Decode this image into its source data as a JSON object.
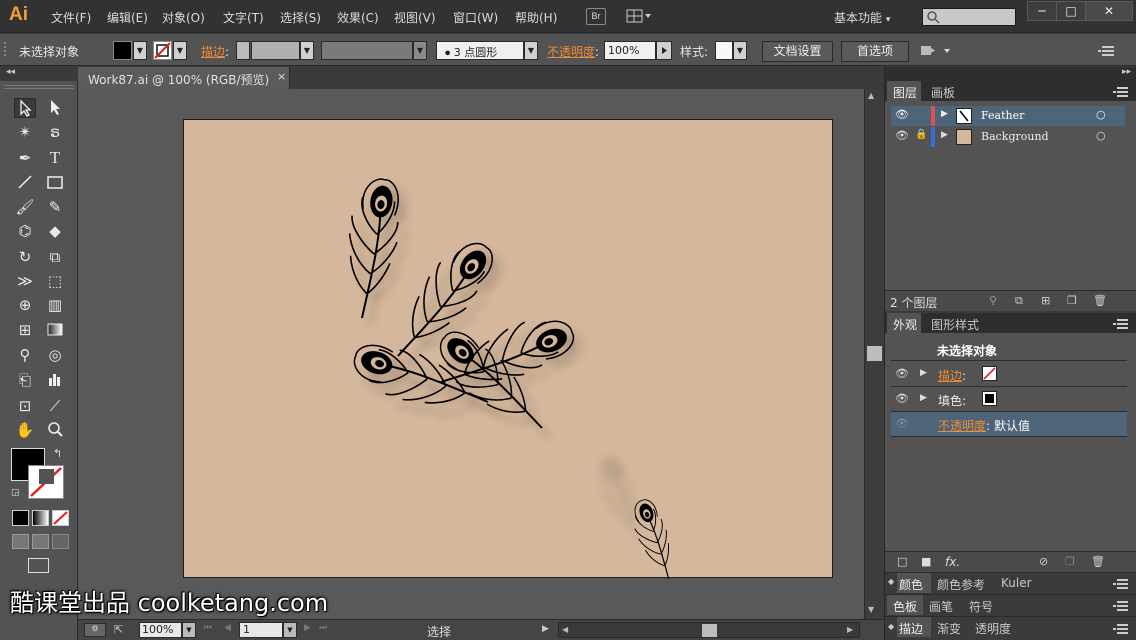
{
  "app": {
    "logo": "Ai"
  },
  "menu": [
    "文件(F)",
    "编辑(E)",
    "对象(O)",
    "文字(T)",
    "选择(S)",
    "效果(C)",
    "视图(V)",
    "窗口(W)",
    "帮助(H)"
  ],
  "menubar": {
    "bridge_label": "Br",
    "workspace": "基本功能",
    "workspace_arrow": "▾",
    "win_min": "─",
    "win_max": "□",
    "win_close": "✕"
  },
  "control": {
    "selection_text": "未选择对象",
    "stroke_label": "描边",
    "stroke_colon": ":",
    "profile": "3 点圆形",
    "opacity_label": "不透明度",
    "opacity_value": "100%",
    "style_label": "样式:",
    "doc_setup": "文档设置",
    "prefs": "首选项"
  },
  "document": {
    "tab_title": "Work87.ai @ 100% (RGB/预览)",
    "close": "×"
  },
  "layers": {
    "tabs": [
      "图层",
      "画板"
    ],
    "rows": [
      {
        "name": "Feather",
        "color": "#e05050",
        "selected": true,
        "locked": false
      },
      {
        "name": "Background",
        "color": "#3070e0",
        "selected": false,
        "locked": true
      }
    ],
    "count_text": "2 个图层"
  },
  "appearance": {
    "tabs": [
      "外观",
      "图形样式"
    ],
    "title": "未选择对象",
    "rows": [
      {
        "label": "描边",
        "suffix": ":",
        "orange": true
      },
      {
        "label": "填色",
        "suffix": ":",
        "orange": false
      },
      {
        "label": "不透明度",
        "suffix": ":",
        "value": "默认值",
        "orange": true
      }
    ],
    "fx_label": "fx."
  },
  "collapsed_panels": [
    [
      "颜色",
      "颜色参考",
      "Kuler"
    ],
    [
      "色板",
      "画笔",
      "符号"
    ],
    [
      "描边",
      "渐变",
      "透明度"
    ]
  ],
  "status": {
    "zoom": "100%",
    "page": "1",
    "tool_name": "选择"
  },
  "watermark": "酷课堂出品 coolketang.com",
  "colors": {
    "accent_orange": "#f08c32",
    "artboard": "#d4b79c",
    "selected_row": "#4e6579"
  }
}
